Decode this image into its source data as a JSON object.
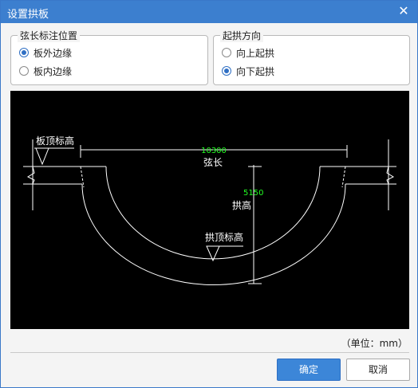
{
  "window": {
    "title": "设置拱板",
    "close_glyph": "✕"
  },
  "chord_position": {
    "title": "弦长标注位置",
    "options": [
      {
        "label": "板外边缘",
        "checked": true
      },
      {
        "label": "板内边缘",
        "checked": false
      }
    ]
  },
  "arch_direction": {
    "title": "起拱方向",
    "options": [
      {
        "label": "向上起拱",
        "checked": false
      },
      {
        "label": "向下起拱",
        "checked": true
      }
    ]
  },
  "diagram": {
    "slab_top_elevation_label": "板顶标高",
    "chord_value": "10300",
    "chord_label": "弦长",
    "arch_height_value": "5150",
    "arch_height_label": "拱高",
    "arch_top_elevation_label": "拱顶标高",
    "colors": {
      "background": "#000000",
      "line": "#ffffff",
      "dimension": "#22ff22"
    }
  },
  "unit_label": "（单位：mm）",
  "buttons": {
    "ok": "确定",
    "cancel": "取消"
  }
}
